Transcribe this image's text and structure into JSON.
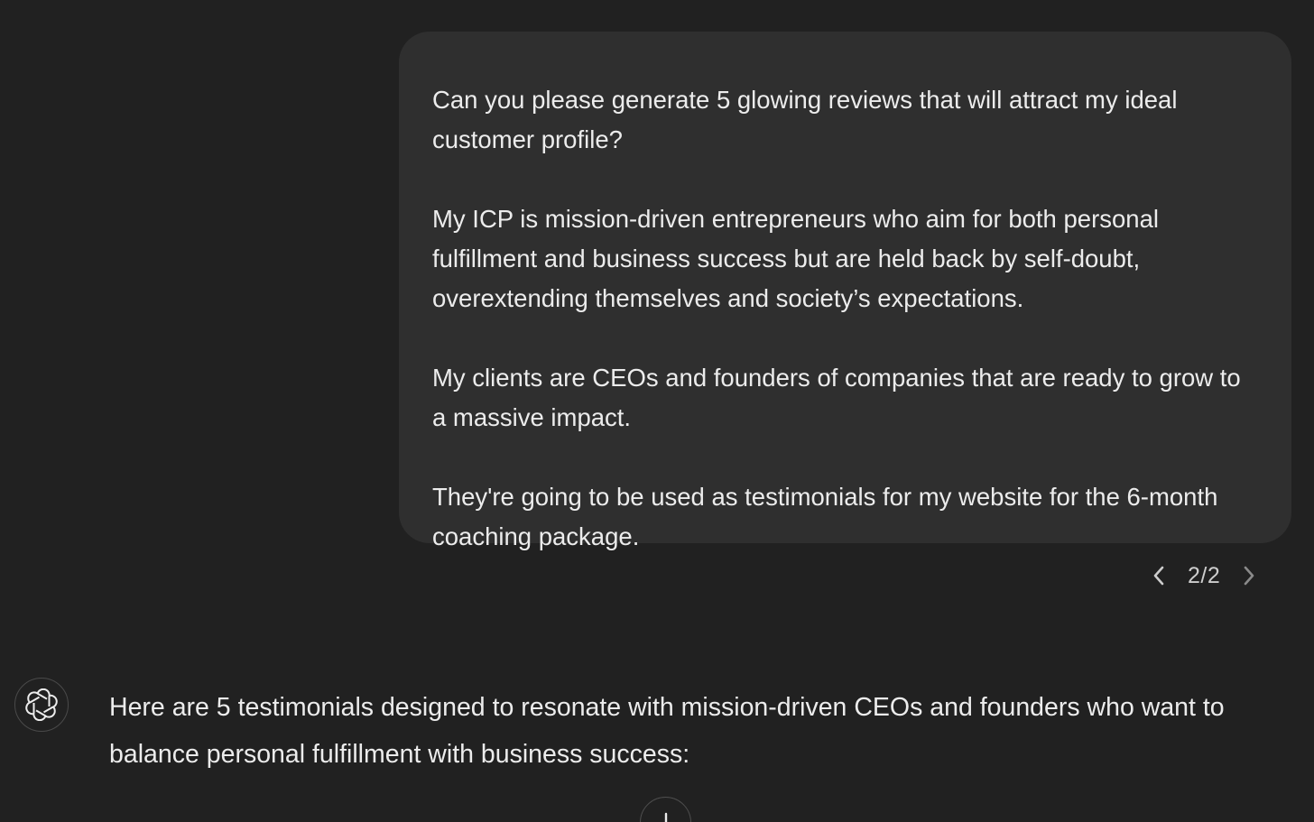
{
  "user_message": {
    "paragraphs": [
      "Can you please generate 5 glowing reviews that will attract my ideal customer profile?",
      "My ICP is mission-driven entrepreneurs who aim for both personal fulfillment and business success but are held back by self-doubt, overextending themselves and society’s expectations.",
      "My clients are CEOs and founders of companies that are ready to grow to a massive impact.",
      "They're going to be used as testimonials for my website for the 6-month coaching package."
    ]
  },
  "pager": {
    "current": "2/2",
    "prev_icon": "chevron-left-icon",
    "next_icon": "chevron-right-icon"
  },
  "assistant_message": {
    "avatar_icon": "openai-logo-icon",
    "text": "Here are 5 testimonials designed to resonate with mission-driven CEOs and founders who want to balance personal fulfillment with business success:"
  },
  "scroll_button": {
    "icon": "arrow-down-icon"
  },
  "colors": {
    "background": "#212121",
    "bubble": "#2f2f2f",
    "text": "#ececec"
  }
}
